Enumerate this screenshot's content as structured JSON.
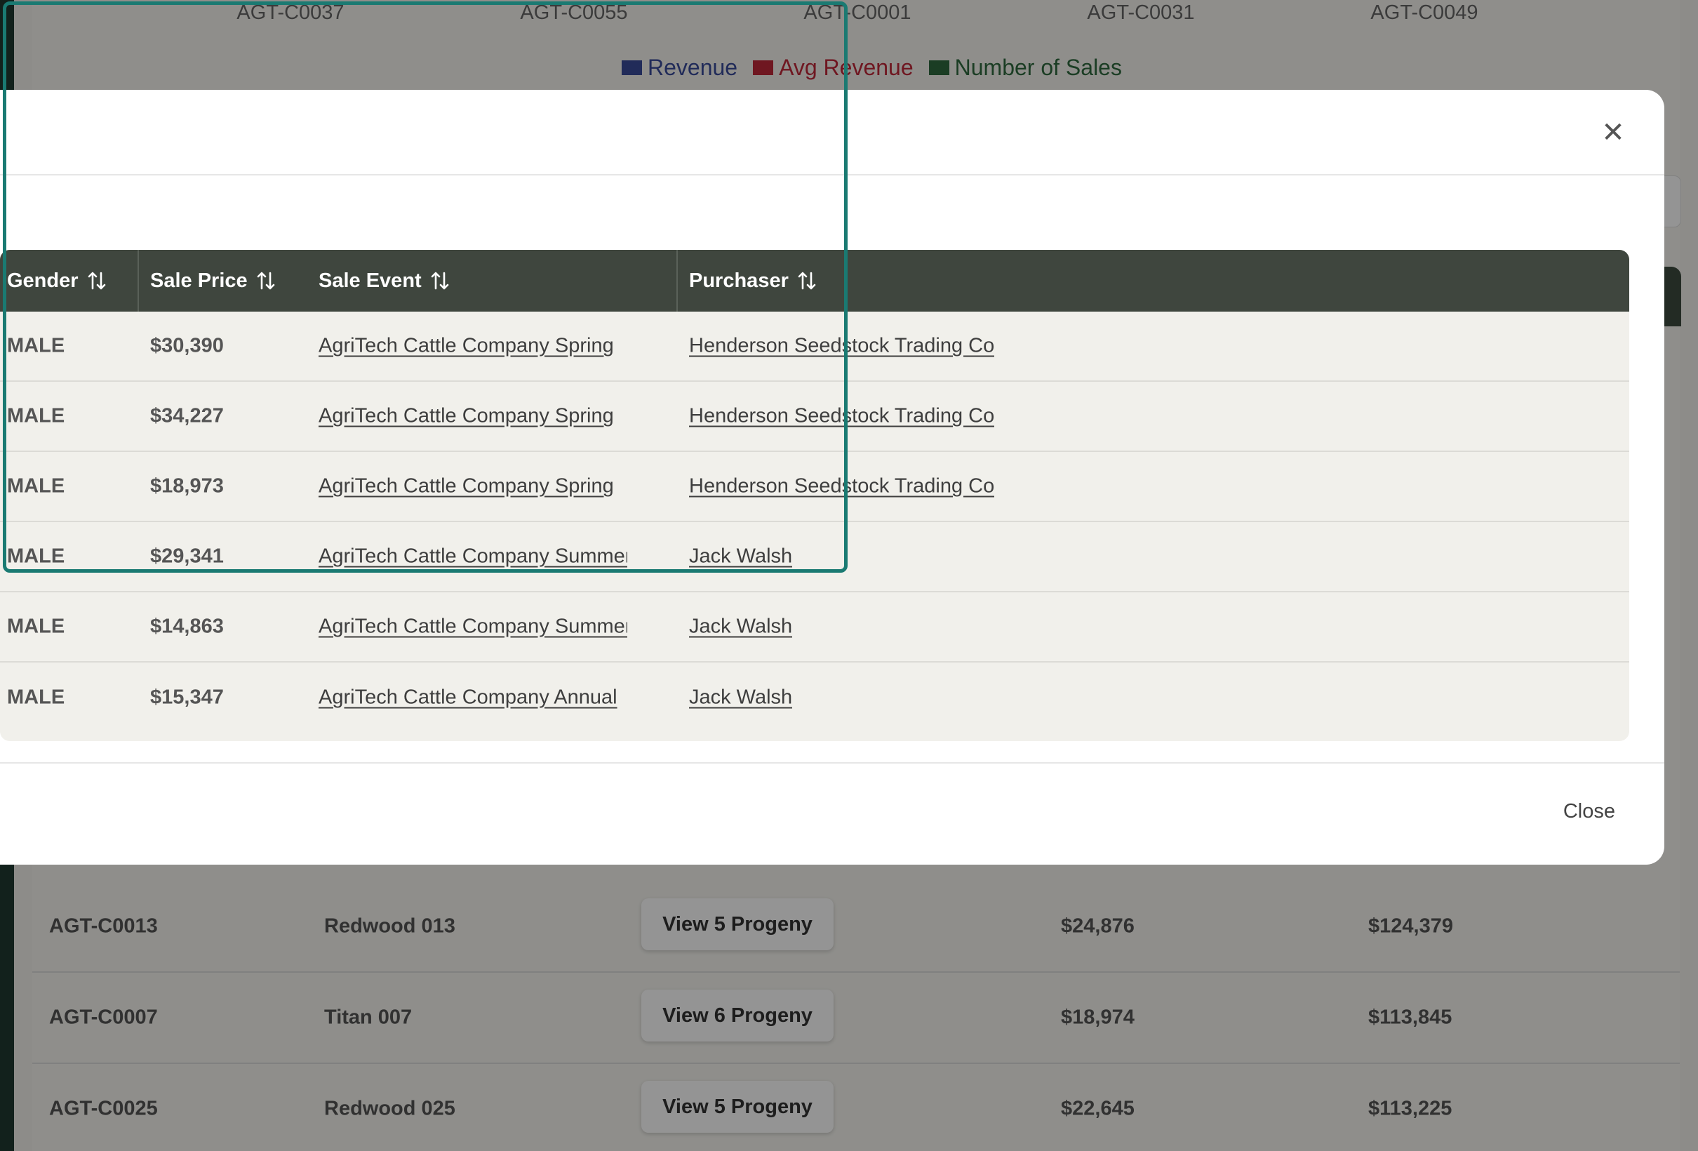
{
  "background": {
    "chart_x_labels": [
      "AGT-C0037",
      "AGT-C0055",
      "AGT-C0001",
      "AGT-C0031",
      "AGT-C0049"
    ],
    "legend": [
      {
        "label": "Revenue",
        "color": "#3a4a9a"
      },
      {
        "label": "Avg Revenue",
        "color": "#c0283a"
      },
      {
        "label": "Number of Sales",
        "color": "#2f6a3e"
      }
    ],
    "rows": [
      {
        "id": "AGT-C0013",
        "name": "Redwood 013",
        "button": "View 5 Progeny",
        "avg": "$24,876",
        "total": "$124,379"
      },
      {
        "id": "AGT-C0007",
        "name": "Titan 007",
        "button": "View 6 Progeny",
        "avg": "$18,974",
        "total": "$113,845"
      },
      {
        "id": "AGT-C0025",
        "name": "Redwood 025",
        "button": "View 5 Progeny",
        "avg": "$22,645",
        "total": "$113,225"
      }
    ]
  },
  "modal": {
    "close_icon": "close-icon",
    "close_button_label": "Close",
    "table": {
      "headers": {
        "gender": "Gender",
        "sale_price": "Sale Price",
        "sale_event": "Sale Event",
        "purchaser": "Purchaser"
      },
      "rows": [
        {
          "gender": "MALE",
          "sale_price": "$30,390",
          "sale_event": "AgriTech Cattle Company Spring",
          "purchaser": "Henderson Seedstock Trading Co"
        },
        {
          "gender": "MALE",
          "sale_price": "$34,227",
          "sale_event": "AgriTech Cattle Company Spring",
          "purchaser": "Henderson Seedstock Trading Co"
        },
        {
          "gender": "MALE",
          "sale_price": "$18,973",
          "sale_event": "AgriTech Cattle Company Spring",
          "purchaser": "Henderson Seedstock Trading Co"
        },
        {
          "gender": "MALE",
          "sale_price": "$29,341",
          "sale_event": "AgriTech Cattle Company Summer",
          "purchaser": "Jack Walsh"
        },
        {
          "gender": "MALE",
          "sale_price": "$14,863",
          "sale_event": "AgriTech Cattle Company Summer",
          "purchaser": "Jack Walsh"
        },
        {
          "gender": "MALE",
          "sale_price": "$15,347",
          "sale_event": "AgriTech Cattle Company Annual",
          "purchaser": "Jack Walsh"
        }
      ]
    }
  },
  "colors": {
    "header_bg": "#3f463e",
    "highlight": "#1a7a72",
    "sidebar": "#1f3a31"
  }
}
